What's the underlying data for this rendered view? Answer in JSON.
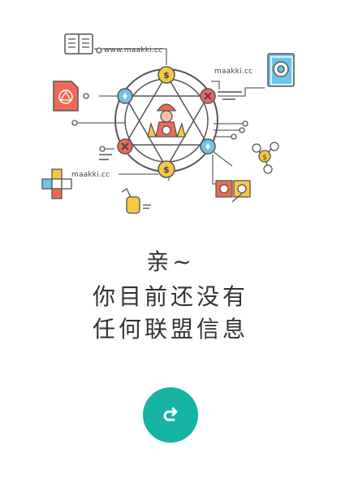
{
  "illustration": {
    "labels": [
      "www.maakki.cc",
      "maakki.cc",
      "maakki.cc"
    ]
  },
  "message": {
    "greeting": "亲~",
    "line1": "你目前还没有",
    "line2": "任何联盟信息"
  },
  "colors": {
    "accent": "#17b3a3",
    "node_yellow": "#f7c844",
    "node_red": "#ee6a55",
    "node_blue": "#6fc3ea",
    "line": "#555555"
  },
  "icons": {
    "refresh": "refresh-icon"
  }
}
